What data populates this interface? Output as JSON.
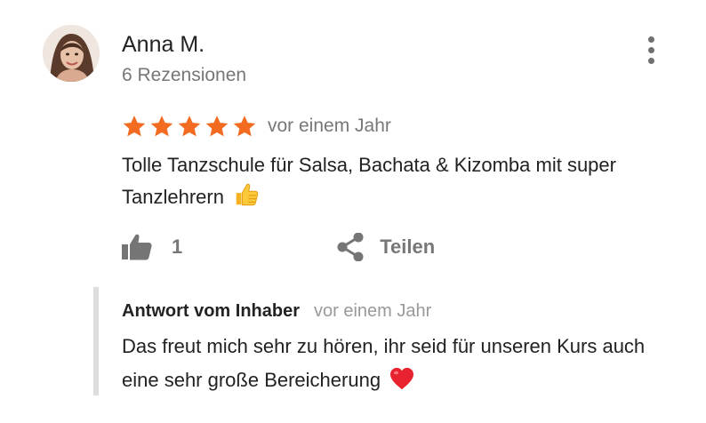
{
  "review": {
    "author_name": "Anna M.",
    "review_count": "6 Rezensionen",
    "rating": 5,
    "rating_max": 5,
    "date": "vor einem Jahr",
    "text": "Tolle Tanzschule für Salsa, Bachata & Kizomba mit super Tanzlehrern",
    "text_emoji": "thumbs-up-emoji",
    "like_count": "1",
    "share_label": "Teilen"
  },
  "owner_reply": {
    "author": "Antwort vom Inhaber",
    "date": "vor einem Jahr",
    "text": "Das freut mich sehr zu hören, ihr seid für unseren Kurs auch eine sehr große Bereicherung",
    "text_emoji": "red-heart-emoji"
  },
  "colors": {
    "star": "#F26B21",
    "muted_text": "#777777",
    "primary_text": "#222222",
    "reply_border": "#dddddd"
  },
  "icons": {
    "menu": "more-vert-icon",
    "like": "thumb-up-icon",
    "share": "share-icon"
  }
}
